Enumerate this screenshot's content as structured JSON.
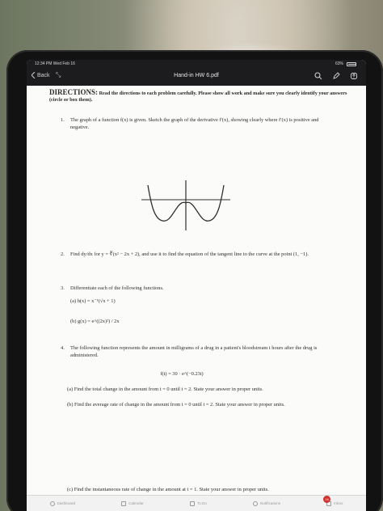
{
  "statusbar": {
    "time": "12:34 PM   Wed Feb 16",
    "battery": "63%"
  },
  "navbar": {
    "back_label": "Back",
    "title": "Hand-in HW 6.pdf"
  },
  "directions": {
    "heading": "DIRECTIONS:",
    "text": "Read the directions to each problem carefully. Please show all work and make sure you clearly identify your answers (circle or box them)."
  },
  "problems": {
    "p1_number": "1.",
    "p1_text": "The graph of a function f(x) is given. Sketch the graph of the derivative f′(x), showing clearly where f′(x) is positive and negative.",
    "p2_number": "2.",
    "p2_text": "Find dy/dx for y = ∛(x² − 2x + 2), and use it to find the equation of the tangent line to the curve at the point (1, −1).",
    "p3_number": "3.",
    "p3_text": "Differentiate each of the following functions.",
    "p3a": "(a) h(x) = x⁻¹(√x + 1)",
    "p3b": "(b) g(x) = e^((2x)²) / 2x",
    "p4_number": "4.",
    "p4_text": "The following function represents the amount in milligrams of a drug in a patient's bloodstream t hours after the drug is administered.",
    "p4_formula": "f(t) = 30 · e^(−0.23t)",
    "p4a": "(a) Find the total change in the amount from t = 0 until t = 2. State your answer in proper units.",
    "p4b": "(b) Find the average rate of change in the amount from t = 0 until t = 2. State your answer in proper units.",
    "p4c": "(c) Find the instantaneous rate of change in the amount at t = 1. State your answer in proper units."
  },
  "tabbar": {
    "items": [
      "Dashboard",
      "Calendar",
      "To Do",
      "Notifications",
      "Inbox"
    ],
    "inbox_badge": "16"
  },
  "icons": [
    "back-chevron-icon",
    "resize-arrows-icon",
    "search-icon",
    "pen-icon",
    "share-icon",
    "dashboard-icon",
    "calendar-icon",
    "todo-icon",
    "bell-icon",
    "inbox-icon"
  ],
  "colors": {
    "topbar": "#1c1c1e",
    "page": "#fbfbfa",
    "badge": "#d0312d"
  }
}
